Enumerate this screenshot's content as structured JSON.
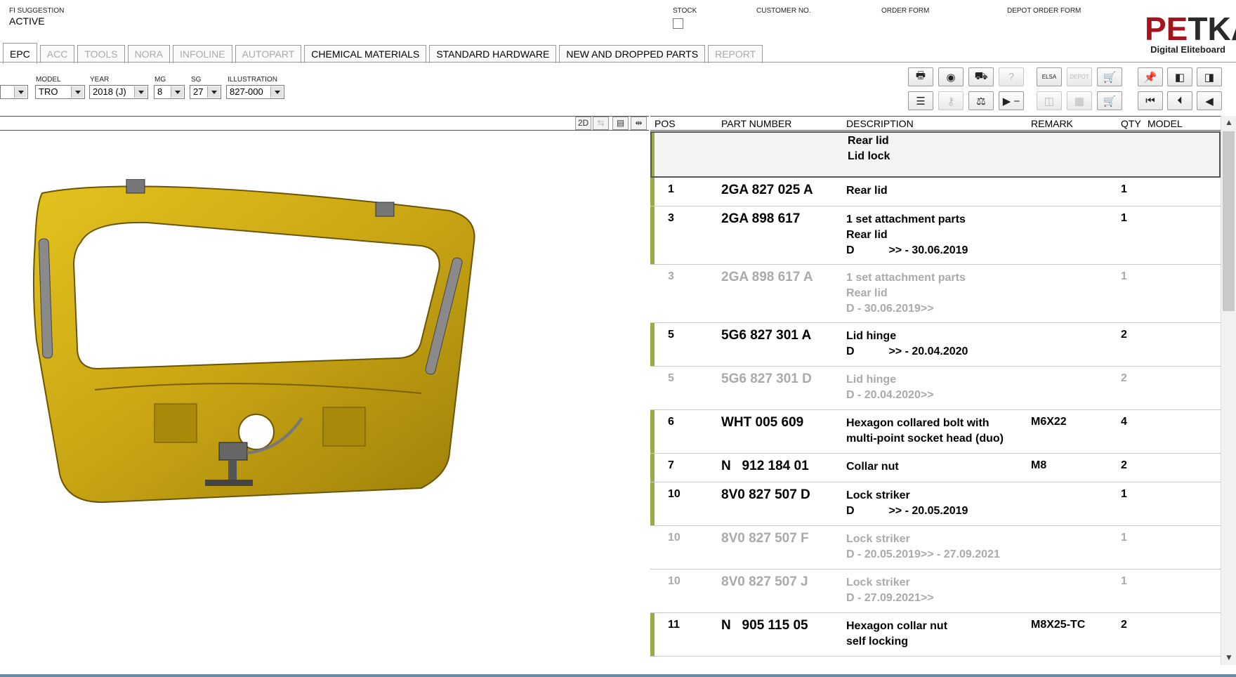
{
  "header": {
    "fi_label": "FI SUGGESTION",
    "fi_value": "ACTIVE",
    "stock_label": "STOCK",
    "customer_label": "CUSTOMER NO.",
    "order_label": "ORDER FORM",
    "depot_label": "DEPOT ORDER FORM"
  },
  "logo": {
    "main_red": "PE",
    "main_rest": "TKA",
    "sub": "Digital Eliteboard"
  },
  "tabs": [
    {
      "label": "EPC",
      "state": "active"
    },
    {
      "label": "ACC",
      "state": "disabled"
    },
    {
      "label": "TOOLS",
      "state": "disabled"
    },
    {
      "label": "NORA",
      "state": "disabled"
    },
    {
      "label": "INFOLINE",
      "state": "disabled"
    },
    {
      "label": "AUTOPART",
      "state": "disabled"
    },
    {
      "label": "CHEMICAL MATERIALS",
      "state": "enabled"
    },
    {
      "label": "STANDARD HARDWARE",
      "state": "enabled"
    },
    {
      "label": "NEW AND DROPPED PARTS",
      "state": "enabled"
    },
    {
      "label": "REPORT",
      "state": "disabled"
    }
  ],
  "selectors": {
    "model_label": "MODEL",
    "model": "TRO",
    "year_label": "YEAR",
    "year": "2018 (J)",
    "mg_label": "MG",
    "mg": "8",
    "sg_label": "SG",
    "sg": "27",
    "ill_label": "ILLUSTRATION",
    "ill": "827-000"
  },
  "viewer": {
    "btn_2d": "2D"
  },
  "table": {
    "headers": {
      "pos": "POS",
      "pn": "PART NUMBER",
      "desc": "DESCRIPTION",
      "rem": "REMARK",
      "qty": "QTY",
      "model": "MODEL"
    },
    "group_desc": "Rear lid\nLid lock",
    "rows": [
      {
        "pos": "1",
        "pn": "2GA 827 025 A",
        "desc": "Rear lid",
        "rem": "",
        "qty": "1",
        "grey": false,
        "h": 41
      },
      {
        "pos": "3",
        "pn": "2GA 898 617",
        "desc": "1 set attachment parts\nRear lid\nD           >> - 30.06.2019",
        "rem": "",
        "qty": "1",
        "grey": false,
        "h": 83
      },
      {
        "pos": "3",
        "pn": "2GA 898 617 A",
        "desc": "1 set attachment parts\nRear lid\nD - 30.06.2019>>",
        "rem": "",
        "qty": "1",
        "grey": true,
        "h": 83
      },
      {
        "pos": "5",
        "pn": "5G6 827 301 A",
        "desc": "Lid hinge\nD           >> - 20.04.2020",
        "rem": "",
        "qty": "2",
        "grey": false,
        "h": 62
      },
      {
        "pos": "5",
        "pn": "5G6 827 301 D",
        "desc": "Lid hinge\nD - 20.04.2020>>",
        "rem": "",
        "qty": "2",
        "grey": true,
        "h": 62
      },
      {
        "pos": "6",
        "pn": "WHT 005 609",
        "desc": "Hexagon collared bolt with\nmulti-point socket head (duo)",
        "rem": "M6X22",
        "qty": "4",
        "grey": false,
        "h": 62
      },
      {
        "pos": "7",
        "pn": "N   912 184 01",
        "desc": "Collar nut",
        "rem": "M8",
        "qty": "2",
        "grey": false,
        "h": 41
      },
      {
        "pos": "10",
        "pn": "8V0 827 507 D",
        "desc": "Lock striker\nD           >> - 20.05.2019",
        "rem": "",
        "qty": "1",
        "grey": false,
        "h": 62
      },
      {
        "pos": "10",
        "pn": "8V0 827 507 F",
        "desc": "Lock striker\nD - 20.05.2019>> - 27.09.2021",
        "rem": "",
        "qty": "1",
        "grey": true,
        "h": 62
      },
      {
        "pos": "10",
        "pn": "8V0 827 507 J",
        "desc": "Lock striker\nD - 27.09.2021>>",
        "rem": "",
        "qty": "1",
        "grey": true,
        "h": 62
      },
      {
        "pos": "11",
        "pn": "N   905 115 05",
        "desc": "Hexagon collar nut\nself locking",
        "rem": "M8X25-TC",
        "qty": "2",
        "grey": false,
        "h": 62
      }
    ]
  },
  "colors": {
    "row_bar": "#9aaa45",
    "panel_yellow": "#c9a514",
    "logo_red": "#a3141d"
  },
  "icons": {
    "toolbar_row1": [
      "print-icon",
      "disc-icon",
      "car-parts-icon",
      "question-icon",
      "elsa-icon",
      "depot-icon",
      "cart-icon",
      "pin-icon",
      "prev-page-icon",
      "next-page-icon"
    ],
    "toolbar_row2": [
      "list-icon",
      "key-icon",
      "scale-icon",
      "play-minus-icon",
      "split-icon",
      "grid-icon",
      "cart-add-icon",
      "first-icon",
      "prev-icon",
      "left-arrow-icon"
    ]
  },
  "elsa_label": "ELSA",
  "depot_btn_label": "DEPOT"
}
